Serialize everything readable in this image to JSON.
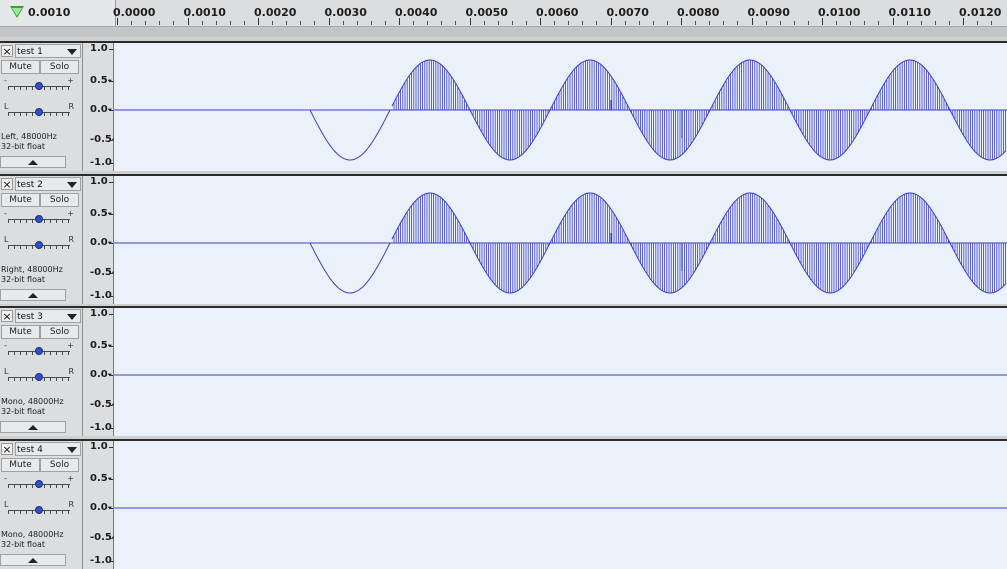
{
  "ruler": {
    "playhead_label": "0.0010",
    "ticks": [
      "0.0000",
      "0.0010",
      "0.0020",
      "0.0030",
      "0.0040",
      "0.0050",
      "0.0060",
      "0.0070",
      "0.0080",
      "0.0090",
      "0.0100",
      "0.0110",
      "0.0120"
    ]
  },
  "colors": {
    "waveform": "#3a40c8",
    "wave_bg": "#eaf1fb",
    "playhead": "#2aa82a"
  },
  "tracks": [
    {
      "name": "test 1",
      "mute": "Mute",
      "solo": "Solo",
      "gain_minus": "-",
      "gain_plus": "+",
      "pan_l": "L",
      "pan_r": "R",
      "info_line1": "Left, 48000Hz",
      "info_line2": "32-bit float",
      "has_audio": true,
      "scale": [
        "1.0",
        "0.5-",
        "0.0-",
        "-0.5-",
        "-1.0"
      ]
    },
    {
      "name": "test 2",
      "mute": "Mute",
      "solo": "Solo",
      "gain_minus": "-",
      "gain_plus": "+",
      "pan_l": "L",
      "pan_r": "R",
      "info_line1": "Right, 48000Hz",
      "info_line2": "32-bit float",
      "has_audio": true,
      "scale": [
        "1.0",
        "0.5-",
        "0.0-",
        "-0.5-",
        "-1.0"
      ]
    },
    {
      "name": "test 3",
      "mute": "Mute",
      "solo": "Solo",
      "gain_minus": "-",
      "gain_plus": "+",
      "pan_l": "L",
      "pan_r": "R",
      "info_line1": "Mono, 48000Hz",
      "info_line2": "32-bit float",
      "has_audio": false,
      "scale": [
        "1.0",
        "0.5-",
        "0.0-",
        "-0.5-",
        "-1.0"
      ]
    },
    {
      "name": "test 4",
      "mute": "Mute",
      "solo": "Solo",
      "gain_minus": "-",
      "gain_plus": "+",
      "pan_l": "L",
      "pan_r": "R",
      "info_line1": "Mono, 48000Hz",
      "info_line2": "32-bit float",
      "has_audio": false,
      "scale": [
        "1.0",
        "0.5-",
        "0.0-",
        "-0.5-",
        "-1.0"
      ]
    }
  ]
}
